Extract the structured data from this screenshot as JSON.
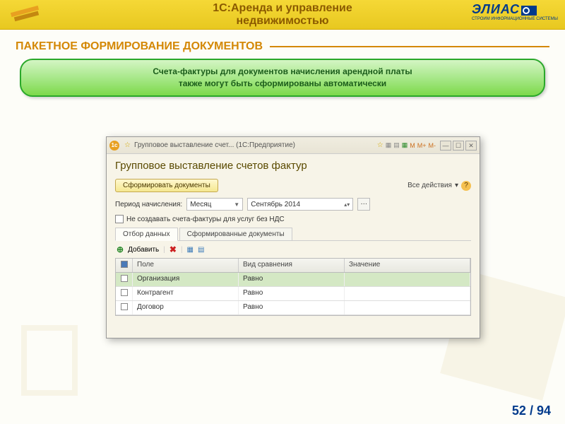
{
  "banner": {
    "title_line1": "1С:Аренда и управление",
    "title_line2": "недвижимостью",
    "logo_text": "ЭЛИАС",
    "logo_sub": "СТРОИМ ИНФОРМАЦИОННЫЕ СИСТЕМЫ"
  },
  "section_title": "ПАКЕТНОЕ ФОРМИРОВАНИЕ ДОКУМЕНТОВ",
  "callout": {
    "line1": "Счета-фактуры для документов начисления арендной платы",
    "line2": "также могут быть сформированы автоматически"
  },
  "window": {
    "titlebar": "Групповое выставление счет... (1С:Предприятие)",
    "form_title": "Групповое выставление счетов фактур",
    "btn_generate": "Сформировать документы",
    "all_actions": "Все действия",
    "period_label": "Период начисления:",
    "period_type": "Месяц",
    "period_value": "Сентябрь 2014",
    "checkbox_label": "Не создавать счета-фактуры для услуг без НДС",
    "tab1": "Отбор данных",
    "tab2": "Сформированные документы",
    "add_label": "Добавить",
    "grid": {
      "headers": {
        "field": "Поле",
        "cmp": "Вид сравнения",
        "val": "Значение"
      },
      "rows": [
        {
          "field": "Организация",
          "cmp": "Равно",
          "val": ""
        },
        {
          "field": "Контрагент",
          "cmp": "Равно",
          "val": ""
        },
        {
          "field": "Договор",
          "cmp": "Равно",
          "val": ""
        }
      ]
    }
  },
  "page": {
    "current": "52",
    "total": "94",
    "sep": " / "
  }
}
